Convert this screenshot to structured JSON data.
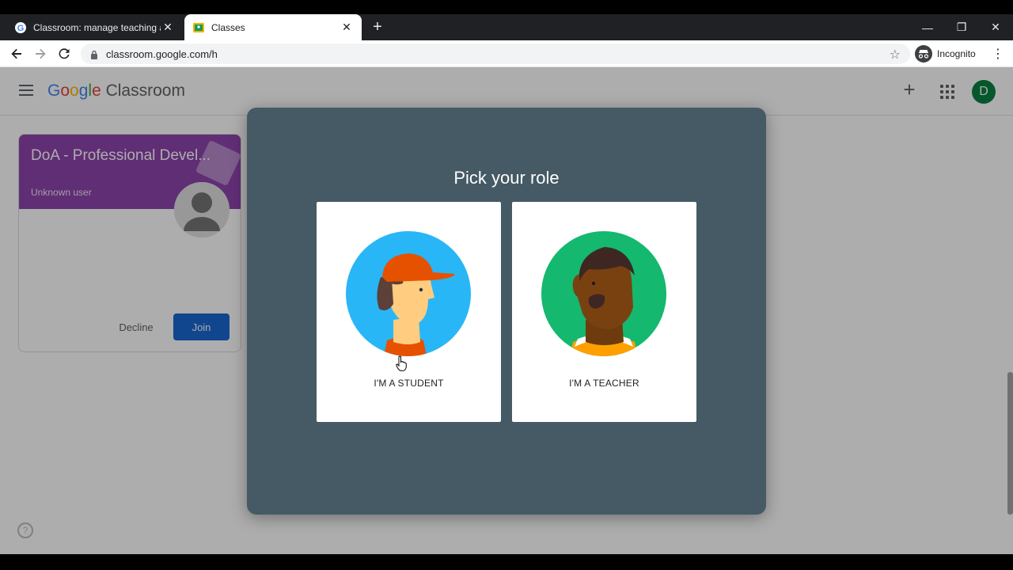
{
  "browser": {
    "tabs": [
      {
        "title": "Classroom: manage teaching and"
      },
      {
        "title": "Classes"
      }
    ],
    "url": "classroom.google.com/h",
    "profile_label": "Incognito",
    "window_controls": {
      "minimize": "—",
      "restore": "❐",
      "close": "✕"
    }
  },
  "app": {
    "brand": {
      "g1": "G",
      "g2": "o",
      "g3": "o",
      "g4": "g",
      "g5": "l",
      "g6": "e",
      "product": " Classroom"
    },
    "account_initial": "D"
  },
  "class_card": {
    "name": "DoA - Professional Devel...",
    "owner": "Unknown user",
    "decline_label": "Decline",
    "join_label": "Join"
  },
  "dialog": {
    "title": "Pick your role",
    "roles": [
      {
        "label": "I'M A STUDENT"
      },
      {
        "label": "I'M A TEACHER"
      }
    ]
  },
  "colors": {
    "dialog_bg": "#455a64",
    "join_button": "#1967d2",
    "student_bg": "#29b6f6",
    "teacher_bg": "#14b86f",
    "banner": "#8e44ad"
  }
}
